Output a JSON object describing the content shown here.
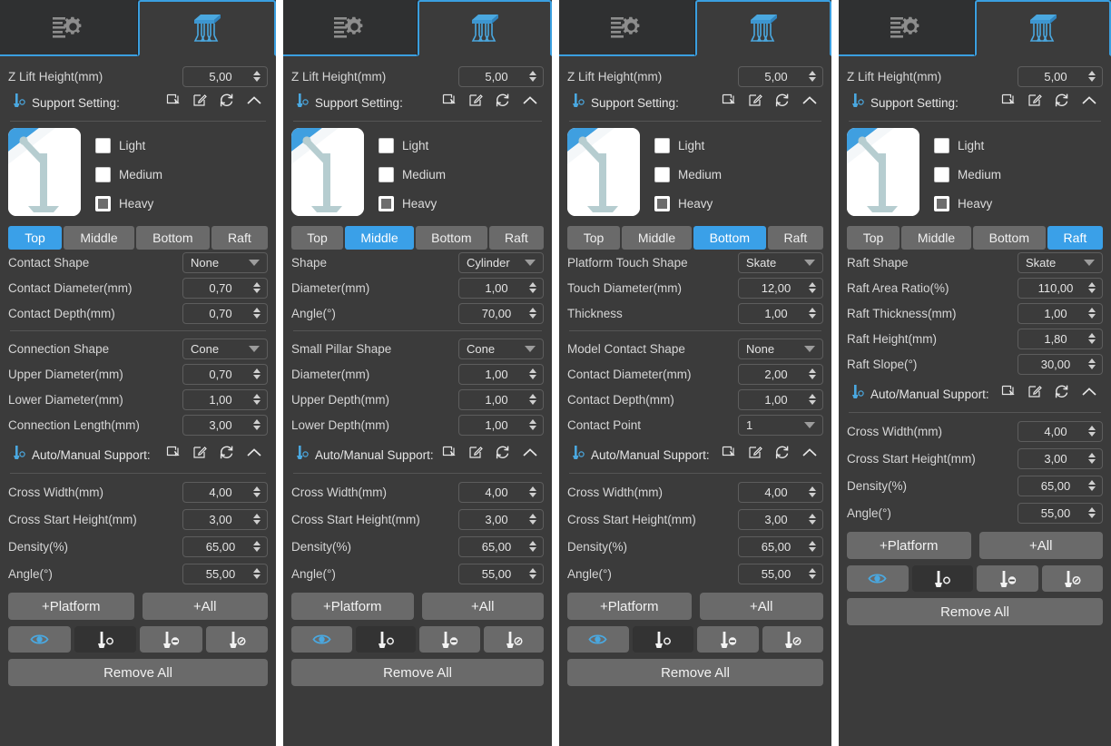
{
  "app": {
    "tabs": [
      {
        "name": "print-settings-tab",
        "icon": "sliders-gear-icon",
        "active": false
      },
      {
        "name": "support-settings-tab",
        "icon": "support-pillars-icon",
        "active": true
      }
    ]
  },
  "common": {
    "z_lift_label": "Z Lift Height(mm)",
    "z_lift_value": "5,00",
    "support_setting_label": "Support Setting:",
    "auto_manual_label": "Auto/Manual Support:",
    "section_actions": [
      "import-icon",
      "edit-icon",
      "reset-icon",
      "collapse-icon"
    ],
    "checkboxes": [
      {
        "label": "Light",
        "checked": false
      },
      {
        "label": "Medium",
        "checked": false
      },
      {
        "label": "Heavy",
        "checked": true
      }
    ],
    "seg_tabs": [
      "Top",
      "Middle",
      "Bottom",
      "Raft"
    ],
    "auto_params": [
      {
        "label": "Cross Width(mm)",
        "value": "4,00",
        "type": "spin"
      },
      {
        "label": "Cross Start Height(mm)",
        "value": "3,00",
        "type": "spin"
      },
      {
        "label": "Density(%)",
        "value": "65,00",
        "type": "spin"
      },
      {
        "label": "Angle(°)",
        "value": "55,00",
        "type": "spin"
      }
    ],
    "add_platform_label": "+Platform",
    "add_all_label": "+All",
    "tool_icons": [
      "eye-icon",
      "add-support-icon",
      "remove-support-icon",
      "edit-support-icon"
    ],
    "remove_all_label": "Remove All",
    "accent": "#3aa0e8",
    "panel_bg": "#3b3b3b"
  },
  "panels": [
    {
      "id": "panel-top",
      "active_seg": "Top",
      "params": [
        {
          "label": "Contact Shape",
          "value": "None",
          "type": "drop"
        },
        {
          "label": "Contact Diameter(mm)",
          "value": "0,70",
          "type": "spin"
        },
        {
          "label": "Contact Depth(mm)",
          "value": "0,70",
          "type": "spin"
        },
        {
          "divider": true
        },
        {
          "label": "Connection Shape",
          "value": "Cone",
          "type": "drop"
        },
        {
          "label": "Upper Diameter(mm)",
          "value": "0,70",
          "type": "spin"
        },
        {
          "label": "Lower Diameter(mm)",
          "value": "1,00",
          "type": "spin"
        },
        {
          "label": "Connection Length(mm)",
          "value": "3,00",
          "type": "spin"
        }
      ]
    },
    {
      "id": "panel-middle",
      "active_seg": "Middle",
      "params": [
        {
          "label": "Shape",
          "value": "Cylinder",
          "type": "drop"
        },
        {
          "label": "Diameter(mm)",
          "value": "1,00",
          "type": "spin"
        },
        {
          "label": "Angle(°)",
          "value": "70,00",
          "type": "spin"
        },
        {
          "divider": true
        },
        {
          "label": "Small Pillar Shape",
          "value": "Cone",
          "type": "drop"
        },
        {
          "label": "Diameter(mm)",
          "value": "1,00",
          "type": "spin"
        },
        {
          "label": "Upper Depth(mm)",
          "value": "1,00",
          "type": "spin"
        },
        {
          "label": "Lower Depth(mm)",
          "value": "1,00",
          "type": "spin"
        }
      ]
    },
    {
      "id": "panel-bottom",
      "active_seg": "Bottom",
      "params": [
        {
          "label": "Platform Touch Shape",
          "value": "Skate",
          "type": "drop"
        },
        {
          "label": "Touch Diameter(mm)",
          "value": "12,00",
          "type": "spin"
        },
        {
          "label": "Thickness",
          "value": "1,00",
          "type": "spin"
        },
        {
          "divider": true
        },
        {
          "label": "Model Contact Shape",
          "value": "None",
          "type": "drop"
        },
        {
          "label": "Contact Diameter(mm)",
          "value": "2,00",
          "type": "spin"
        },
        {
          "label": "Contact Depth(mm)",
          "value": "1,00",
          "type": "spin"
        },
        {
          "label": "Contact Point",
          "value": "1",
          "type": "drop"
        }
      ]
    },
    {
      "id": "panel-raft",
      "active_seg": "Raft",
      "params": [
        {
          "label": "Raft Shape",
          "value": "Skate",
          "type": "drop"
        },
        {
          "label": "Raft Area Ratio(%)",
          "value": "110,00",
          "type": "spin"
        },
        {
          "label": "Raft Thickness(mm)",
          "value": "1,00",
          "type": "spin"
        },
        {
          "label": "Raft Height(mm)",
          "value": "1,80",
          "type": "spin"
        },
        {
          "label": "Raft Slope(°)",
          "value": "30,00",
          "type": "spin"
        }
      ]
    }
  ]
}
